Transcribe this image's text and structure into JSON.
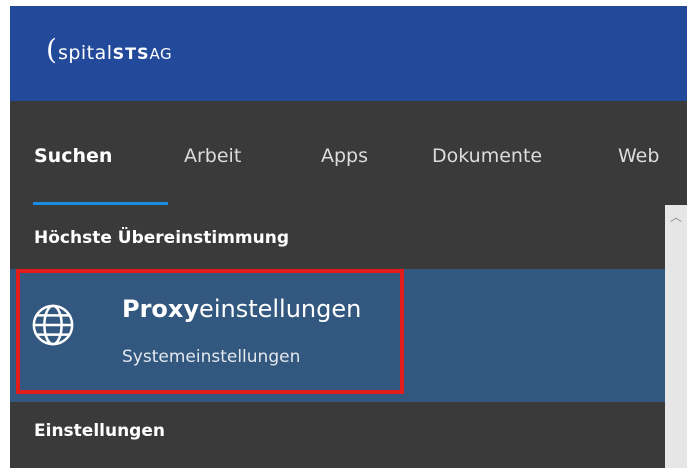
{
  "brand": {
    "paren": "(",
    "name": "spital",
    "sts": "STS",
    "ag": "AG"
  },
  "tabs": [
    {
      "label": "Suchen",
      "active": true
    },
    {
      "label": "Arbeit",
      "active": false
    },
    {
      "label": "Apps",
      "active": false
    },
    {
      "label": "Dokumente",
      "active": false
    },
    {
      "label": "Web",
      "active": false
    }
  ],
  "results": {
    "best_match_heading": "Höchste Übereinstimmung",
    "best_match": {
      "title_bold": "Proxy",
      "title_rest": "einstellungen",
      "subtitle": "Systemeinstellungen",
      "icon": "globe-icon"
    },
    "settings_heading": "Einstellungen"
  },
  "colors": {
    "brand_bar": "#234a9a",
    "panel": "#3a3a3a",
    "selected_row": "#33587f",
    "tab_accent": "#1a8be0",
    "highlight_border": "#e21b1b"
  }
}
